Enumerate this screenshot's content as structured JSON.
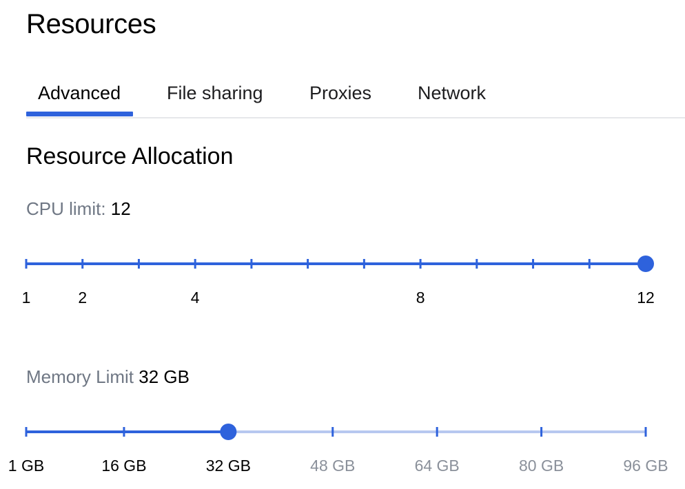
{
  "page": {
    "title": "Resources"
  },
  "tabs": [
    {
      "label": "Advanced",
      "active": true
    },
    {
      "label": "File sharing",
      "active": false
    },
    {
      "label": "Proxies",
      "active": false
    },
    {
      "label": "Network",
      "active": false
    }
  ],
  "section": {
    "title": "Resource Allocation"
  },
  "cpu": {
    "label": "CPU limit:",
    "value_text": "12",
    "min": 1,
    "max": 12,
    "value": 12,
    "step": 1,
    "tick_labels": [
      {
        "value": 1,
        "text": "1"
      },
      {
        "value": 2,
        "text": "2"
      },
      {
        "value": 4,
        "text": "4"
      },
      {
        "value": 8,
        "text": "8"
      },
      {
        "value": 12,
        "text": "12"
      }
    ]
  },
  "memory": {
    "label": "Memory Limit",
    "value_text": "32 GB",
    "min": 1,
    "max": 96,
    "value": 32,
    "tick_labels": [
      {
        "value": 1,
        "text": "1 GB"
      },
      {
        "value": 16,
        "text": "16 GB"
      },
      {
        "value": 32,
        "text": "32 GB"
      },
      {
        "value": 48,
        "text": "48 GB"
      },
      {
        "value": 64,
        "text": "64 GB"
      },
      {
        "value": 80,
        "text": "80 GB"
      },
      {
        "value": 96,
        "text": "96 GB"
      }
    ]
  },
  "colors": {
    "accent": "#2e62dc",
    "track_inactive": "#b7c8f0",
    "label_muted": "#6f7784",
    "tick_label_inactive": "#8a909a",
    "divider": "#e6e7ea"
  }
}
